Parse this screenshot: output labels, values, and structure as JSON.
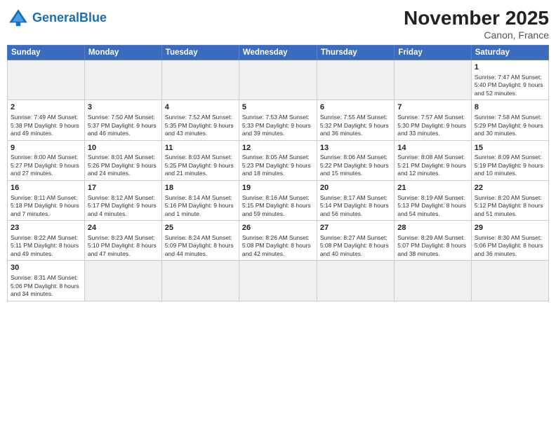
{
  "logo": {
    "general": "General",
    "blue": "Blue"
  },
  "title": "November 2025",
  "location": "Canon, France",
  "days_header": [
    "Sunday",
    "Monday",
    "Tuesday",
    "Wednesday",
    "Thursday",
    "Friday",
    "Saturday"
  ],
  "weeks": [
    [
      {
        "day": "",
        "empty": true
      },
      {
        "day": "",
        "empty": true
      },
      {
        "day": "",
        "empty": true
      },
      {
        "day": "",
        "empty": true
      },
      {
        "day": "",
        "empty": true
      },
      {
        "day": "",
        "empty": true
      },
      {
        "day": "1",
        "info": "Sunrise: 7:47 AM\nSunset: 5:40 PM\nDaylight: 9 hours\nand 52 minutes."
      }
    ],
    [
      {
        "day": "2",
        "info": "Sunrise: 7:49 AM\nSunset: 5:38 PM\nDaylight: 9 hours\nand 49 minutes."
      },
      {
        "day": "3",
        "info": "Sunrise: 7:50 AM\nSunset: 5:37 PM\nDaylight: 9 hours\nand 46 minutes."
      },
      {
        "day": "4",
        "info": "Sunrise: 7:52 AM\nSunset: 5:35 PM\nDaylight: 9 hours\nand 43 minutes."
      },
      {
        "day": "5",
        "info": "Sunrise: 7:53 AM\nSunset: 5:33 PM\nDaylight: 9 hours\nand 39 minutes."
      },
      {
        "day": "6",
        "info": "Sunrise: 7:55 AM\nSunset: 5:32 PM\nDaylight: 9 hours\nand 36 minutes."
      },
      {
        "day": "7",
        "info": "Sunrise: 7:57 AM\nSunset: 5:30 PM\nDaylight: 9 hours\nand 33 minutes."
      },
      {
        "day": "8",
        "info": "Sunrise: 7:58 AM\nSunset: 5:29 PM\nDaylight: 9 hours\nand 30 minutes."
      }
    ],
    [
      {
        "day": "9",
        "info": "Sunrise: 8:00 AM\nSunset: 5:27 PM\nDaylight: 9 hours\nand 27 minutes."
      },
      {
        "day": "10",
        "info": "Sunrise: 8:01 AM\nSunset: 5:26 PM\nDaylight: 9 hours\nand 24 minutes."
      },
      {
        "day": "11",
        "info": "Sunrise: 8:03 AM\nSunset: 5:25 PM\nDaylight: 9 hours\nand 21 minutes."
      },
      {
        "day": "12",
        "info": "Sunrise: 8:05 AM\nSunset: 5:23 PM\nDaylight: 9 hours\nand 18 minutes."
      },
      {
        "day": "13",
        "info": "Sunrise: 8:06 AM\nSunset: 5:22 PM\nDaylight: 9 hours\nand 15 minutes."
      },
      {
        "day": "14",
        "info": "Sunrise: 8:08 AM\nSunset: 5:21 PM\nDaylight: 9 hours\nand 12 minutes."
      },
      {
        "day": "15",
        "info": "Sunrise: 8:09 AM\nSunset: 5:19 PM\nDaylight: 9 hours\nand 10 minutes."
      }
    ],
    [
      {
        "day": "16",
        "info": "Sunrise: 8:11 AM\nSunset: 5:18 PM\nDaylight: 9 hours\nand 7 minutes."
      },
      {
        "day": "17",
        "info": "Sunrise: 8:12 AM\nSunset: 5:17 PM\nDaylight: 9 hours\nand 4 minutes."
      },
      {
        "day": "18",
        "info": "Sunrise: 8:14 AM\nSunset: 5:16 PM\nDaylight: 9 hours\nand 1 minute."
      },
      {
        "day": "19",
        "info": "Sunrise: 8:16 AM\nSunset: 5:15 PM\nDaylight: 8 hours\nand 59 minutes."
      },
      {
        "day": "20",
        "info": "Sunrise: 8:17 AM\nSunset: 5:14 PM\nDaylight: 8 hours\nand 56 minutes."
      },
      {
        "day": "21",
        "info": "Sunrise: 8:19 AM\nSunset: 5:13 PM\nDaylight: 8 hours\nand 54 minutes."
      },
      {
        "day": "22",
        "info": "Sunrise: 8:20 AM\nSunset: 5:12 PM\nDaylight: 8 hours\nand 51 minutes."
      }
    ],
    [
      {
        "day": "23",
        "info": "Sunrise: 8:22 AM\nSunset: 5:11 PM\nDaylight: 8 hours\nand 49 minutes."
      },
      {
        "day": "24",
        "info": "Sunrise: 8:23 AM\nSunset: 5:10 PM\nDaylight: 8 hours\nand 47 minutes."
      },
      {
        "day": "25",
        "info": "Sunrise: 8:24 AM\nSunset: 5:09 PM\nDaylight: 8 hours\nand 44 minutes."
      },
      {
        "day": "26",
        "info": "Sunrise: 8:26 AM\nSunset: 5:08 PM\nDaylight: 8 hours\nand 42 minutes."
      },
      {
        "day": "27",
        "info": "Sunrise: 8:27 AM\nSunset: 5:08 PM\nDaylight: 8 hours\nand 40 minutes."
      },
      {
        "day": "28",
        "info": "Sunrise: 8:29 AM\nSunset: 5:07 PM\nDaylight: 8 hours\nand 38 minutes."
      },
      {
        "day": "29",
        "info": "Sunrise: 8:30 AM\nSunset: 5:06 PM\nDaylight: 8 hours\nand 36 minutes."
      }
    ],
    [
      {
        "day": "30",
        "info": "Sunrise: 8:31 AM\nSunset: 5:06 PM\nDaylight: 8 hours\nand 34 minutes."
      },
      {
        "day": "",
        "empty": true
      },
      {
        "day": "",
        "empty": true
      },
      {
        "day": "",
        "empty": true
      },
      {
        "day": "",
        "empty": true
      },
      {
        "day": "",
        "empty": true
      },
      {
        "day": "",
        "empty": true
      }
    ]
  ]
}
